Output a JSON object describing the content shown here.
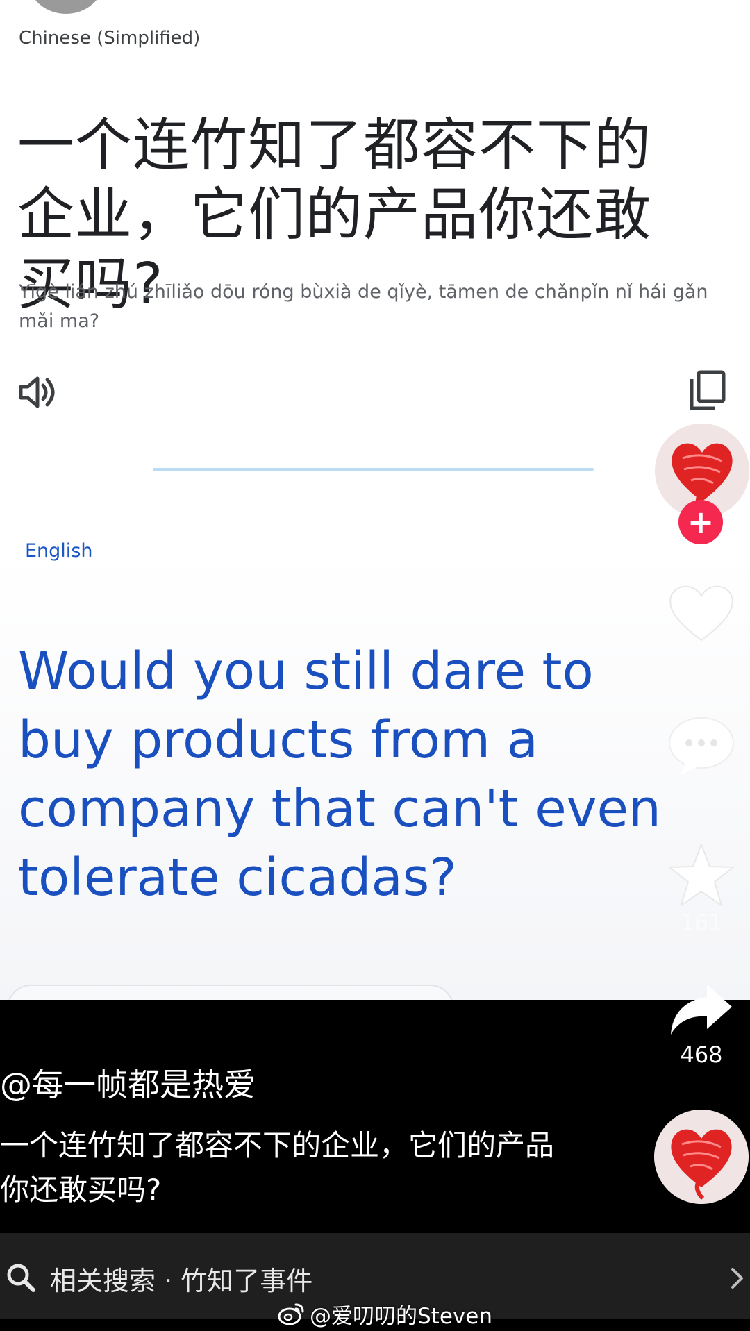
{
  "translation": {
    "source_language": "Chinese (Simplified)",
    "source_text": "一个连竹知了都容不下的企业，它们的产品你还敢买吗?",
    "romanization": "Yīgè lián zhú zhīliǎo dōu róng bùxià de qǐyè, tāmen de chǎnpǐn nǐ hái gǎn mǎi ma?",
    "target_language": "English",
    "target_text": "Would you still dare to buy products from a company that can't even tolerate cicadas?"
  },
  "sidebar": {
    "star_count": "161",
    "share_count": "468"
  },
  "post": {
    "handle": "@每一帧都是热爱",
    "caption": "一个连竹知了都容不下的企业，它们的产品你还敢买吗?"
  },
  "related_search": {
    "text": "相关搜索 · 竹知了事件"
  },
  "watermark": {
    "text": "@爱叨叨的Steven"
  },
  "colors": {
    "translation_blue": "#1a4fbf",
    "follow_red": "#f5284f",
    "heart_red": "#e02424"
  },
  "icons": [
    "speaker-icon",
    "copy-icon",
    "follow-plus-icon",
    "heart-icon",
    "comment-icon",
    "star-icon",
    "share-icon",
    "search-icon",
    "chevron-right-icon",
    "weibo-logo"
  ]
}
